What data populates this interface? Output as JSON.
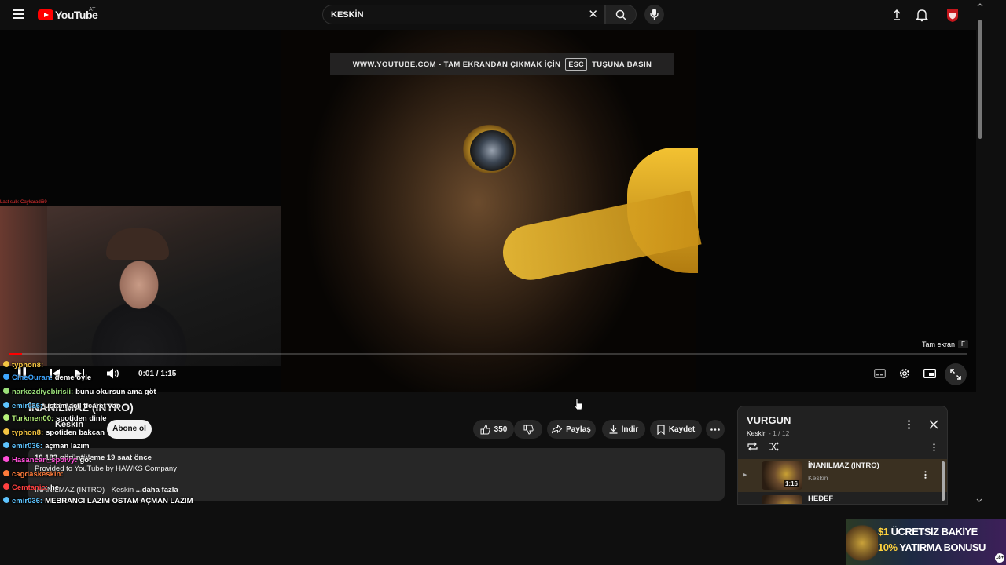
{
  "header": {
    "logo_text": "YouTube",
    "country_code": "AT",
    "search_query": "KESKİN",
    "clear_symbol": "✕"
  },
  "player": {
    "fullscreen_notice_left": "WWW.YOUTUBE.COM - TAM EKRANDAN ÇIKMAK İÇİN",
    "fullscreen_notice_key": "ESC",
    "fullscreen_notice_right": "TUŞUNA BASIN",
    "time": "0:01 / 1:15",
    "progress": 0.013,
    "fullscreen_tooltip": "Tam ekran",
    "fullscreen_tooltip_key": "F",
    "webcam_label": "Last sub: Caykaradi69"
  },
  "video": {
    "title": "İNANILMAZ (INTRO)",
    "channel": "Keskin",
    "subscribe_label": "Abone ol",
    "likes": "350",
    "share_label": "Paylaş",
    "download_label": "İndir",
    "save_label": "Kaydet",
    "views_line": "10.183 görüntüleme  19 saat önce",
    "provided_line": "Provided to YouTube by HAWKS Company",
    "desc_line": "İNANILMAZ (INTRO) · Keskin",
    "more_label": "...daha fazla"
  },
  "chat": [
    {
      "user": "typhon8:",
      "msg": "",
      "color": "#f5c542"
    },
    {
      "user": "CineOuran:",
      "msg": "deme öyle",
      "color": "#3ea6ff"
    },
    {
      "user": "narkozdiyebirisii:",
      "msg": "bunu okursun ama göt",
      "color": "#9be07a"
    },
    {
      "user": "emir036:",
      "msg": "ustam acil ticaret var",
      "color": "#5ec4ff"
    },
    {
      "user": "Turkmen00:",
      "msg": "spotiden dinle",
      "color": "#b7f27b"
    },
    {
      "user": "typhon8:",
      "msg": "spotiden bakcan",
      "color": "#f5c542"
    },
    {
      "user": "emir036:",
      "msg": "açman lazım",
      "color": "#5ec4ff"
    },
    {
      "user": "Hasancan_spoivy:",
      "msg": "göt",
      "color": "#ff4fd8"
    },
    {
      "user": "cagdaskeskin:",
      "msg": "",
      "color": "#ff7b3a"
    },
    {
      "user": "Cemtanic:",
      "msg": "he",
      "color": "#ff4040"
    },
    {
      "user": "emir036:",
      "msg": "MEBRANCI LAZIM OSTAM AÇMAN LAZIM",
      "color": "#5ec4ff"
    }
  ],
  "playlist": {
    "title": "VURGUN",
    "channel": "Keskin",
    "position": "1 / 12",
    "items": [
      {
        "name": "İNANILMAZ (INTRO)",
        "artist": "Keskin",
        "duration": "1:16"
      },
      {
        "name": "HEDEF",
        "artist": "",
        "duration": ""
      }
    ]
  },
  "ad": {
    "line1_accent": "$1",
    "line1": "ÜCRETSİZ BAKİYE",
    "line2_accent": "10%",
    "line2": "YATIRMA BONUSU",
    "badge": "18+"
  }
}
